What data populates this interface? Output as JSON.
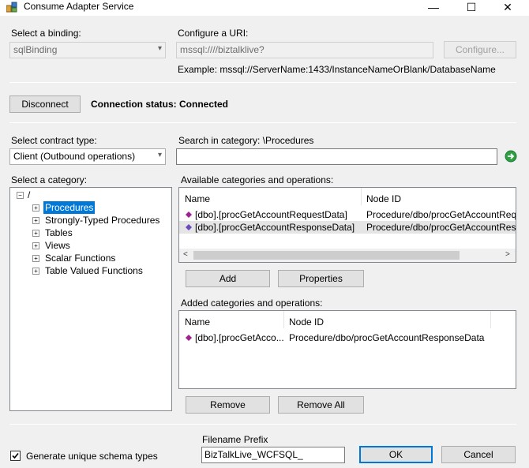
{
  "window": {
    "title": "Consume Adapter Service",
    "minimize": "—",
    "maximize": "☐",
    "close": "✕"
  },
  "binding": {
    "label": "Select a binding:",
    "value": "sqlBinding"
  },
  "uri": {
    "label": "Configure a URI:",
    "value": "mssql:////biztalklive?",
    "configure_label": "Configure...",
    "example": "Example: mssql://ServerName:1433/InstanceNameOrBlank/DatabaseName"
  },
  "connection": {
    "disconnect_label": "Disconnect",
    "status": "Connection status: Connected"
  },
  "contract": {
    "label": "Select contract type:",
    "value": "Client (Outbound operations)"
  },
  "search": {
    "label": "Search in category: \\Procedures",
    "value": ""
  },
  "category": {
    "label": "Select a category:",
    "root": "/",
    "items": [
      "Procedures",
      "Strongly-Typed Procedures",
      "Tables",
      "Views",
      "Scalar Functions",
      "Table Valued Functions"
    ]
  },
  "available": {
    "label": "Available categories and operations:",
    "columns": [
      "Name",
      "Node ID"
    ],
    "rows": [
      {
        "name": "[dbo].[procGetAccountRequestData]",
        "node": "Procedure/dbo/procGetAccountRequestData"
      },
      {
        "name": "[dbo].[procGetAccountResponseData]",
        "node": "Procedure/dbo/procGetAccountResponseData"
      }
    ]
  },
  "actions": {
    "add_label": "Add",
    "properties_label": "Properties"
  },
  "added": {
    "label": "Added categories and operations:",
    "columns": [
      "Name",
      "Node ID"
    ],
    "rows": [
      {
        "name": "[dbo].[procGetAcco...",
        "node": "Procedure/dbo/procGetAccountResponseData"
      }
    ]
  },
  "remove": {
    "remove_label": "Remove",
    "remove_all_label": "Remove All"
  },
  "footer": {
    "generate_label": "Generate unique schema types",
    "generate_checked": true,
    "prefix_label": "Filename Prefix",
    "prefix_value": "BizTalkLive_WCFSQL_",
    "ok_label": "OK",
    "cancel_label": "Cancel"
  },
  "colors": {
    "selection": "#0078d7",
    "go_button": "#2ea043"
  }
}
